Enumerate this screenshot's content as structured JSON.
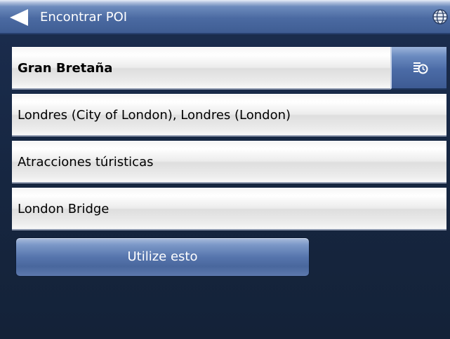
{
  "header": {
    "title": "Encontrar POI"
  },
  "rows": {
    "country": "Gran Bretaña",
    "city": "Londres (City of London), Londres (London)",
    "category": "Atracciones túristicas",
    "poi": "London Bridge"
  },
  "actions": {
    "use_label": "Utilize esto"
  },
  "icons": {
    "back": "back-arrow-icon",
    "globe": "globe-icon",
    "recent": "recent-history-icon"
  },
  "colors": {
    "header_blue": "#4b6aa2",
    "background_navy": "#172847",
    "button_blue": "#5675ad",
    "row_gray": "#ececec"
  }
}
